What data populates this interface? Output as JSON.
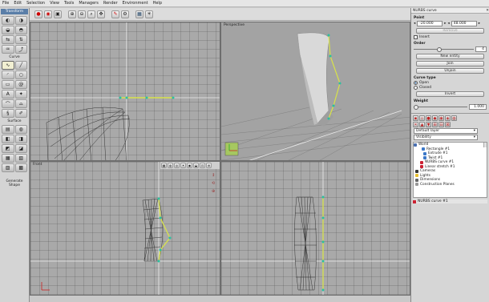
{
  "menu": [
    "File",
    "Edit",
    "Selection",
    "View",
    "Tools",
    "Managers",
    "Render",
    "Environment",
    "Help"
  ],
  "left_panel": {
    "transform_title": "Transform",
    "curve_caption": "Curve",
    "surface_caption": "Surface",
    "generate_caption": "Generate Shape"
  },
  "viewports": {
    "top_left_label": "",
    "top_right_label": "Perspective",
    "bottom_left_label": "Front",
    "bottom_right_label": ""
  },
  "properties": {
    "title": "NURBS curve",
    "point_label": "Point",
    "point_x": "-20.000",
    "point_y": "48.000",
    "remove_label": "Remove",
    "insert_label": "Insert",
    "order_label": "Order",
    "order_value": "4",
    "new_entity_label": "New entity",
    "join_label": "Join",
    "unjoin_label": "Unjoin",
    "curve_type_label": "Curve type",
    "open_label": "Open",
    "closed_label": "Closed",
    "invert_label": "Invert",
    "weight_label": "Weight",
    "weight_value": "1.000"
  },
  "layers": {
    "layer_select": "Default layer",
    "visibility_select": "Visibility"
  },
  "tree": {
    "world": "World",
    "rectangle": "Rectangle #1",
    "extrude": "Extrude #1",
    "twist": "Twist #1",
    "nurbs1": "NURBS curve #1",
    "linear": "Linear stretch #1",
    "cameras": "Cameras",
    "lights": "Lights",
    "dimensions": "Dimensions",
    "planes": "Construction Planes",
    "nurbs_sel": "NURBS curve #1"
  },
  "colors": {
    "accent": "#5a7ea8",
    "curve": "#d8e34a",
    "control_point": "#2bbfa0"
  }
}
